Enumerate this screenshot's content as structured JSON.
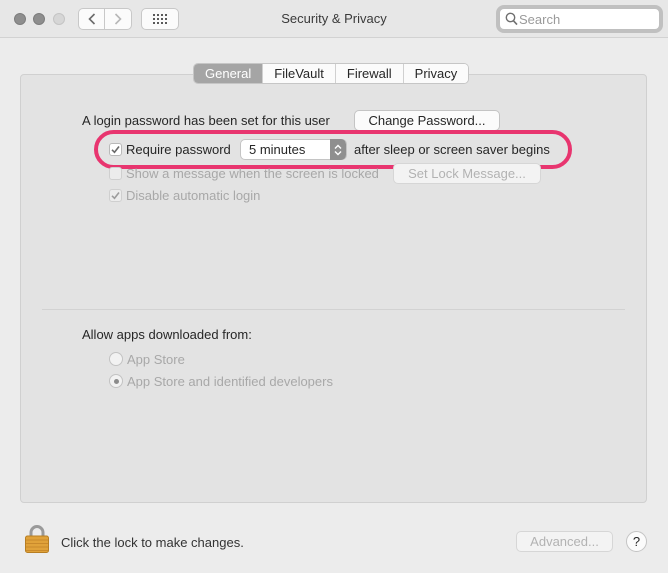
{
  "window": {
    "title": "Security & Privacy",
    "search_placeholder": "Search"
  },
  "tabs": [
    {
      "label": "General",
      "active": true
    },
    {
      "label": "FileVault",
      "active": false
    },
    {
      "label": "Firewall",
      "active": false
    },
    {
      "label": "Privacy",
      "active": false
    }
  ],
  "general": {
    "login_password_text": "A login password has been set for this user",
    "change_password_label": "Change Password...",
    "require_password_label": "Require password",
    "require_password_checked": true,
    "require_password_delay": "5 minutes",
    "after_sleep_text": "after sleep or screen saver begins",
    "show_message_label": "Show a message when the screen is locked",
    "show_message_checked": false,
    "set_lock_message_label": "Set Lock Message...",
    "disable_auto_login_label": "Disable automatic login",
    "disable_auto_login_checked": true
  },
  "downloads": {
    "heading": "Allow apps downloaded from:",
    "options": [
      {
        "label": "App Store",
        "selected": false
      },
      {
        "label": "App Store and identified developers",
        "selected": true
      }
    ]
  },
  "footer": {
    "lock_text": "Click the lock to make changes.",
    "advanced_label": "Advanced...",
    "help_label": "?"
  },
  "colors": {
    "highlight": "#e8356f",
    "active_tab": "#a5a5a5",
    "lock_gold": "#e0a23a"
  },
  "icons": [
    "close-icon",
    "minimize-icon",
    "zoom-icon",
    "back-icon",
    "forward-icon",
    "grid-icon",
    "search-icon",
    "checkmark-icon",
    "stepper-icon",
    "lock-icon",
    "help-icon"
  ]
}
